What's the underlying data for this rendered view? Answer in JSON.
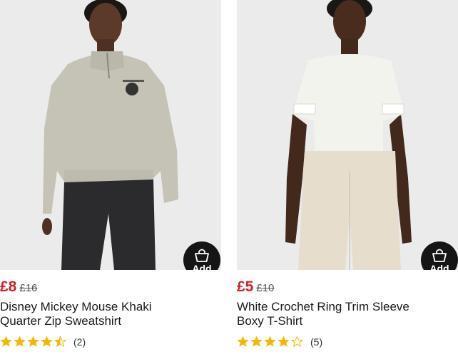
{
  "colors": {
    "sale_price": "#d11f25",
    "star": "#f5b800",
    "add_button": "#151515"
  },
  "products": [
    {
      "price_now": "£8",
      "price_was": "£16",
      "title_line1": "Disney Mickey Mouse Khaki",
      "title_line2": "Quarter Zip Sweatshirt",
      "rating": 4.5,
      "review_count": "(2)",
      "add_label": "Add",
      "image_icon": "product-photo-sweatshirt"
    },
    {
      "price_now": "£5",
      "price_was": "£10",
      "title_line1": "White Crochet Ring Trim Sleeve",
      "title_line2": "Boxy T-Shirt",
      "rating": 4,
      "review_count": "(5)",
      "add_label": "Add",
      "image_icon": "product-photo-tshirt"
    }
  ]
}
